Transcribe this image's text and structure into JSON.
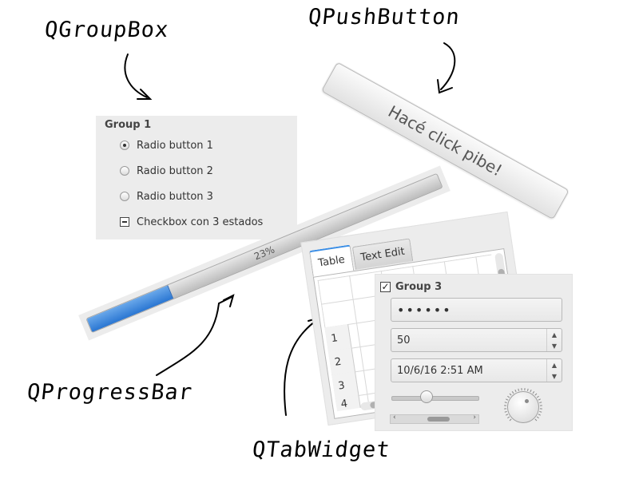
{
  "annotations": {
    "groupbox": "QGroupBox",
    "pushbutton": "QPushButton",
    "progressbar": "QProgressBar",
    "tabwidget": "QTabWidget"
  },
  "group1": {
    "title": "Group 1",
    "options": [
      {
        "label": "Radio button 1",
        "checked": true
      },
      {
        "label": "Radio button 2",
        "checked": false
      },
      {
        "label": "Radio button 3",
        "checked": false
      }
    ],
    "tristate_label": "Checkbox con 3 estados"
  },
  "push_button": {
    "label": "Hacé click pibe!"
  },
  "progress": {
    "value": 0.23,
    "text": "23%",
    "fill_color": "#3a86dc"
  },
  "tab_widget": {
    "tabs": [
      {
        "label": "Table",
        "active": true
      },
      {
        "label": "Text Edit",
        "active": false
      }
    ],
    "row_headers": [
      "1",
      "2",
      "3",
      "4"
    ]
  },
  "group3": {
    "title": "Group 3",
    "checked": true,
    "password": "••••••",
    "spin_value": "50",
    "datetime_value": "10/6/16 2:51 AM",
    "slider_value": 0.4
  },
  "colors": {
    "accent": "#3a8ee6",
    "panel": "#ececec"
  }
}
